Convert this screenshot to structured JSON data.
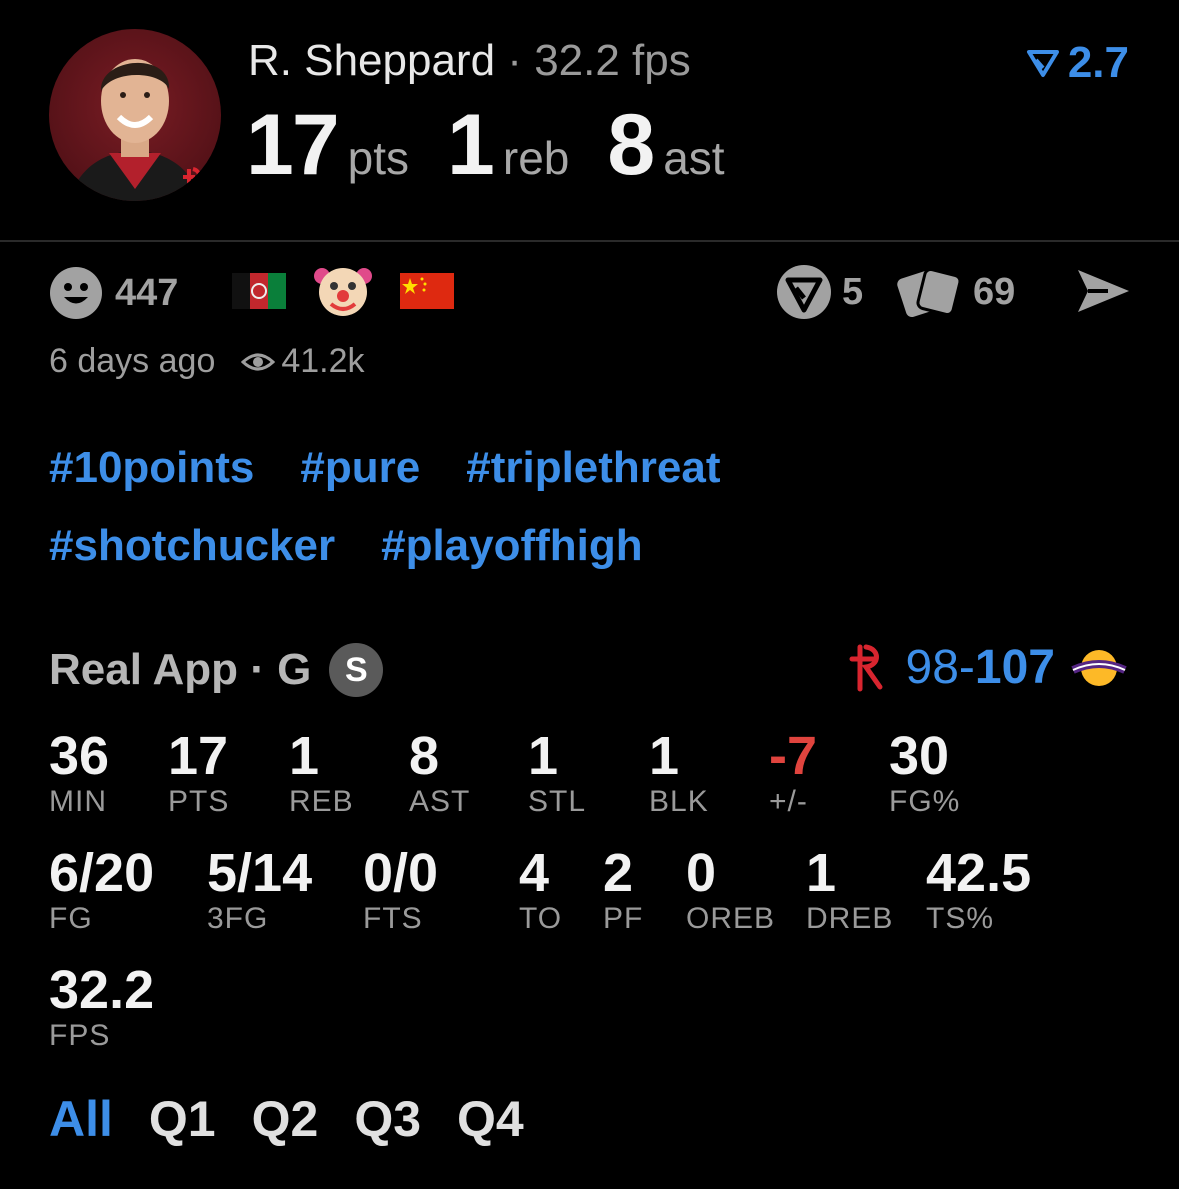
{
  "header": {
    "player_name": "R. Sheppard",
    "separator": "·",
    "fps_text": "32.2 fps",
    "rating": "2.7",
    "points_value": "17",
    "points_unit": "pts",
    "rebounds_value": "1",
    "rebounds_unit": "reb",
    "assists_value": "8",
    "assists_unit": "ast"
  },
  "reactions": {
    "smiley_count": "447",
    "flags": [
      "afghanistan-flag",
      "clown-emoji",
      "china-flag"
    ],
    "vote_count": "5",
    "cards_count": "69"
  },
  "meta": {
    "time_ago": "6 days ago",
    "views": "41.2k"
  },
  "hashtags": {
    "row1": [
      "#10points",
      "#pure",
      "#triplethreat"
    ],
    "row2": [
      "#shotchucker",
      "#playoffhigh"
    ]
  },
  "game": {
    "label": "Real App · G",
    "badge": "S",
    "score_home": "98",
    "score_sep": "-",
    "score_away": "107"
  },
  "stats": {
    "min": {
      "value": "36",
      "label": "MIN"
    },
    "pts": {
      "value": "17",
      "label": "PTS"
    },
    "reb": {
      "value": "1",
      "label": "REB"
    },
    "ast": {
      "value": "8",
      "label": "AST"
    },
    "stl": {
      "value": "1",
      "label": "STL"
    },
    "blk": {
      "value": "1",
      "label": "BLK"
    },
    "pm": {
      "value": "-7",
      "label": "+/-"
    },
    "fgp": {
      "value": "30",
      "label": "FG%"
    },
    "fg": {
      "value": "6/20",
      "label": "FG"
    },
    "fg3": {
      "value": "5/14",
      "label": "3FG"
    },
    "fts": {
      "value": "0/0",
      "label": "FTS"
    },
    "to": {
      "value": "4",
      "label": "TO"
    },
    "pf": {
      "value": "2",
      "label": "PF"
    },
    "oreb": {
      "value": "0",
      "label": "OREB"
    },
    "dreb": {
      "value": "1",
      "label": "DREB"
    },
    "tsp": {
      "value": "42.5",
      "label": "TS%"
    },
    "fps": {
      "value": "32.2",
      "label": "FPS"
    }
  },
  "tabs": [
    "All",
    "Q1",
    "Q2",
    "Q3",
    "Q4"
  ],
  "colors": {
    "accent": "#3d8ee8",
    "negative": "#e0443e",
    "background": "#000000"
  }
}
